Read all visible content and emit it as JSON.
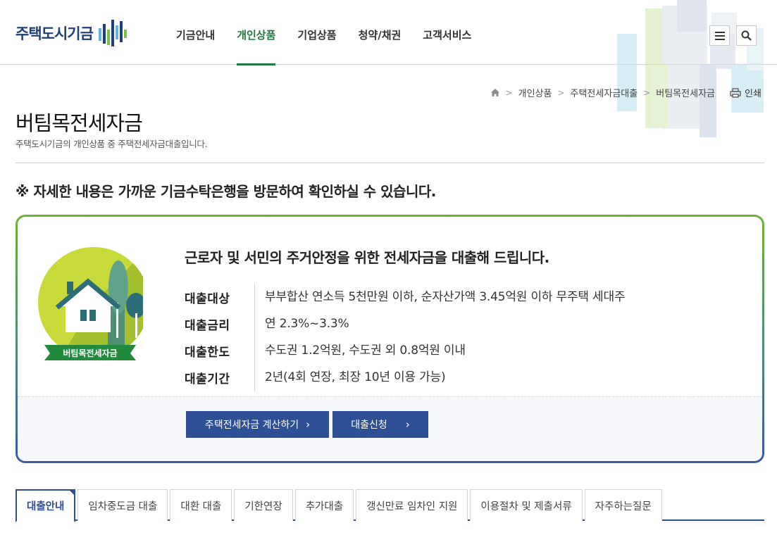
{
  "header": {
    "logo_text": "주택도시기금",
    "nav": [
      {
        "label": "기금안내"
      },
      {
        "label": "개인상품"
      },
      {
        "label": "기업상품"
      },
      {
        "label": "청약/채권"
      },
      {
        "label": "고객서비스"
      }
    ],
    "active_nav_index": 1
  },
  "breadcrumb": {
    "items": [
      "개인상품",
      "주택전세자금대출",
      "버팀목전세자금"
    ]
  },
  "print_label": "인쇄",
  "page": {
    "title": "버팀목전세자금",
    "description": "주택도시기금의 개인상품 중 주택전세자금대출입니다."
  },
  "notice": "※ 자세한 내용은 가까운 기금수탁은행을 방문하여 확인하실 수 있습니다.",
  "product": {
    "emblem_label": "버팀목전세자금",
    "headline": "근로자 및 서민의 주거안정을 위한 전세자금을 대출해 드립니다.",
    "info": [
      {
        "label": "대출대상",
        "value": "부부합산 연소득 5천만원 이하, 순자산가액 3.45억원 이하 무주택 세대주"
      },
      {
        "label": "대출금리",
        "value": "연 2.3%~3.3%"
      },
      {
        "label": "대출한도",
        "value": "수도권 1.2억원, 수도권 외 0.8억원 이내"
      },
      {
        "label": "대출기간",
        "value": "2년(4회 연장, 최장 10년 이용 가능)"
      }
    ],
    "buttons": {
      "calc": "주택전세자금 계산하기",
      "apply": "대출신청"
    }
  },
  "tabs": [
    {
      "label": "대출안내"
    },
    {
      "label": "임차중도금 대출"
    },
    {
      "label": "대환 대출"
    },
    {
      "label": "기한연장"
    },
    {
      "label": "추가대출"
    },
    {
      "label": "갱신만료 임차인 지원"
    },
    {
      "label": "이용절차 및 제출서류"
    },
    {
      "label": "자주하는질문"
    }
  ],
  "colors": {
    "brand_navy": "#2f4f94",
    "brand_green": "#1f7a3e",
    "logo_navy": "#1d3f7a"
  }
}
